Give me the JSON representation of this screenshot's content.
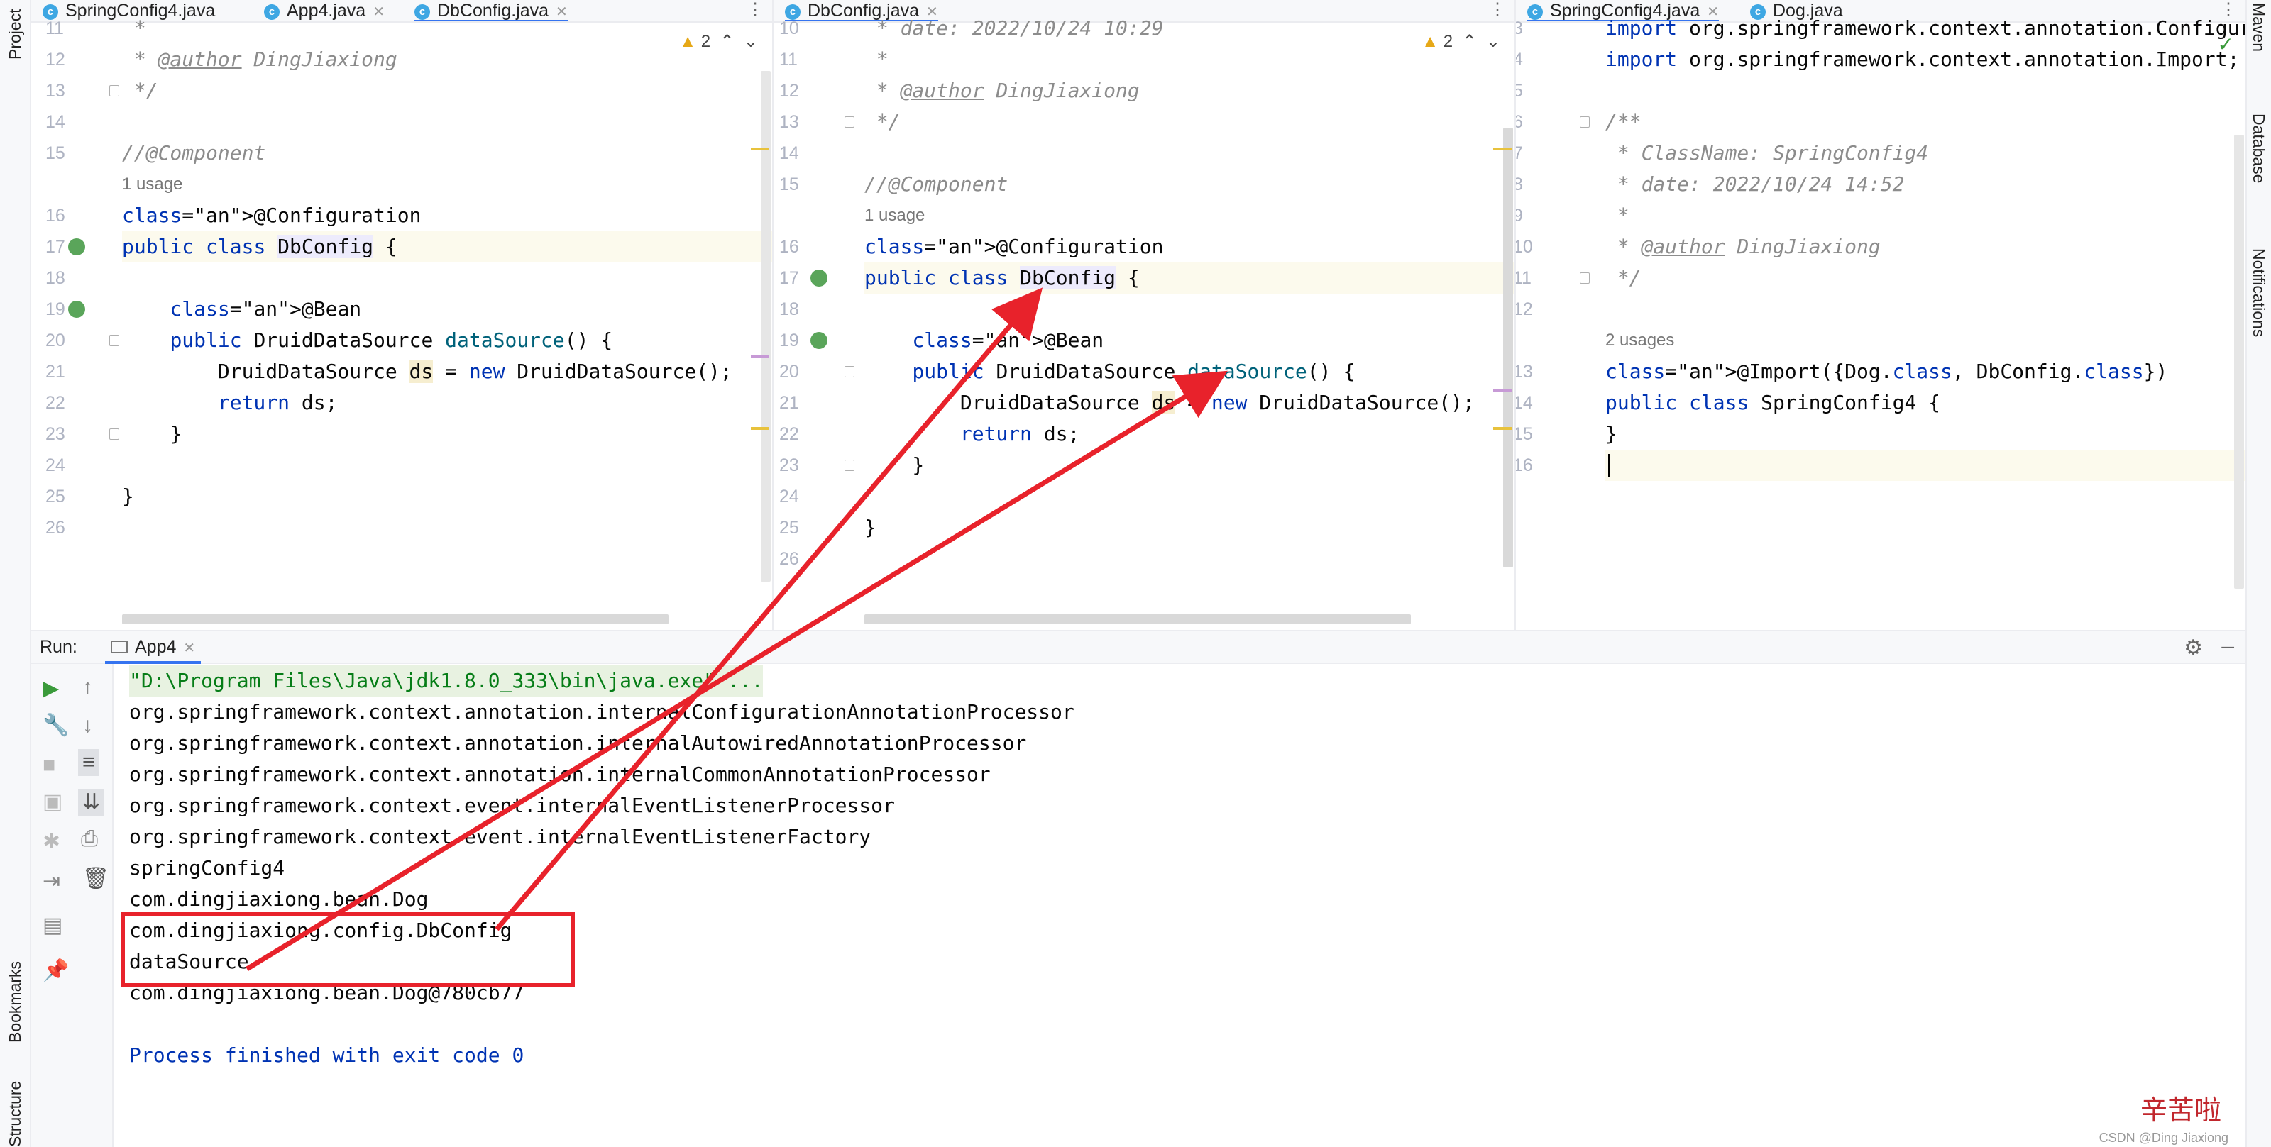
{
  "left_sidebar": {
    "project": "Project",
    "bookmarks": "Bookmarks",
    "structure": "Structure"
  },
  "right_sidebar": {
    "maven": "Maven",
    "database": "Database",
    "notifications": "Notifications"
  },
  "pane1": {
    "tabs": [
      {
        "label": "SpringConfig4.java",
        "active": false
      },
      {
        "label": "App4.java",
        "active": false
      },
      {
        "label": "DbConfig.java",
        "active": true
      }
    ],
    "warnings": "2",
    "lines": [
      {
        "no": "11",
        "text": " *"
      },
      {
        "no": "12",
        "text": " * @author DingJiaxiong"
      },
      {
        "no": "13",
        "text": " */"
      },
      {
        "no": "14",
        "text": ""
      },
      {
        "no": "15",
        "text": "//@Component"
      },
      {
        "no": "",
        "text": "1 usage"
      },
      {
        "no": "16",
        "text": "@Configuration"
      },
      {
        "no": "17",
        "text": "public class DbConfig {"
      },
      {
        "no": "18",
        "text": ""
      },
      {
        "no": "19",
        "text": "    @Bean"
      },
      {
        "no": "20",
        "text": "    public DruidDataSource dataSource() {"
      },
      {
        "no": "21",
        "text": "        DruidDataSource ds = new DruidDataSource();"
      },
      {
        "no": "22",
        "text": "        return ds;"
      },
      {
        "no": "23",
        "text": "    }"
      },
      {
        "no": "24",
        "text": ""
      },
      {
        "no": "25",
        "text": "}"
      },
      {
        "no": "26",
        "text": ""
      }
    ]
  },
  "pane2": {
    "tabs": [
      {
        "label": "DbConfig.java",
        "active": true
      }
    ],
    "warnings": "2",
    "lines": [
      {
        "no": "10",
        "text": " * date: 2022/10/24 10:29"
      },
      {
        "no": "11",
        "text": " *"
      },
      {
        "no": "12",
        "text": " * @author DingJiaxiong"
      },
      {
        "no": "13",
        "text": " */"
      },
      {
        "no": "14",
        "text": ""
      },
      {
        "no": "15",
        "text": "//@Component"
      },
      {
        "no": "",
        "text": "1 usage"
      },
      {
        "no": "16",
        "text": "@Configuration"
      },
      {
        "no": "17",
        "text": "public class DbConfig {"
      },
      {
        "no": "18",
        "text": ""
      },
      {
        "no": "19",
        "text": "    @Bean"
      },
      {
        "no": "20",
        "text": "    public DruidDataSource dataSource() {"
      },
      {
        "no": "21",
        "text": "        DruidDataSource ds = new DruidDataSource();"
      },
      {
        "no": "22",
        "text": "        return ds;"
      },
      {
        "no": "23",
        "text": "    }"
      },
      {
        "no": "24",
        "text": ""
      },
      {
        "no": "25",
        "text": "}"
      },
      {
        "no": "26",
        "text": ""
      }
    ]
  },
  "pane3": {
    "tabs": [
      {
        "label": "SpringConfig4.java",
        "active": true
      },
      {
        "label": "Dog.java",
        "active": false
      }
    ],
    "lines": [
      {
        "no": "3",
        "text": "import org.springframework.context.annotation.Configuration;"
      },
      {
        "no": "4",
        "text": "import org.springframework.context.annotation.Import;"
      },
      {
        "no": "5",
        "text": ""
      },
      {
        "no": "6",
        "text": "/**"
      },
      {
        "no": "7",
        "text": " * ClassName: SpringConfig4"
      },
      {
        "no": "8",
        "text": " * date: 2022/10/24 14:52"
      },
      {
        "no": "9",
        "text": " *"
      },
      {
        "no": "10",
        "text": " * @author DingJiaxiong"
      },
      {
        "no": "11",
        "text": " */"
      },
      {
        "no": "12",
        "text": ""
      },
      {
        "no": "",
        "text": "2 usages"
      },
      {
        "no": "13",
        "text": "@Import({Dog.class, DbConfig.class})"
      },
      {
        "no": "14",
        "text": "public class SpringConfig4 {"
      },
      {
        "no": "15",
        "text": "}"
      },
      {
        "no": "16",
        "text": ""
      }
    ]
  },
  "run": {
    "label": "Run:",
    "tab": "App4",
    "output": [
      "\"D:\\Program Files\\Java\\jdk1.8.0_333\\bin\\java.exe\" ...",
      "org.springframework.context.annotation.internalConfigurationAnnotationProcessor",
      "org.springframework.context.annotation.internalAutowiredAnnotationProcessor",
      "org.springframework.context.annotation.internalCommonAnnotationProcessor",
      "org.springframework.context.event.internalEventListenerProcessor",
      "org.springframework.context.event.internalEventListenerFactory",
      "springConfig4",
      "com.dingjiaxiong.bean.Dog",
      "com.dingjiaxiong.config.DbConfig",
      "dataSource",
      "com.dingjiaxiong.bean.Dog@780cb77",
      "",
      "Process finished with exit code 0"
    ]
  },
  "watermark": {
    "text": "辛苦啦",
    "small": "CSDN @Ding Jiaxiong"
  },
  "colors": {
    "annotation_red": "#e8222b",
    "accent": "#3574f0"
  }
}
